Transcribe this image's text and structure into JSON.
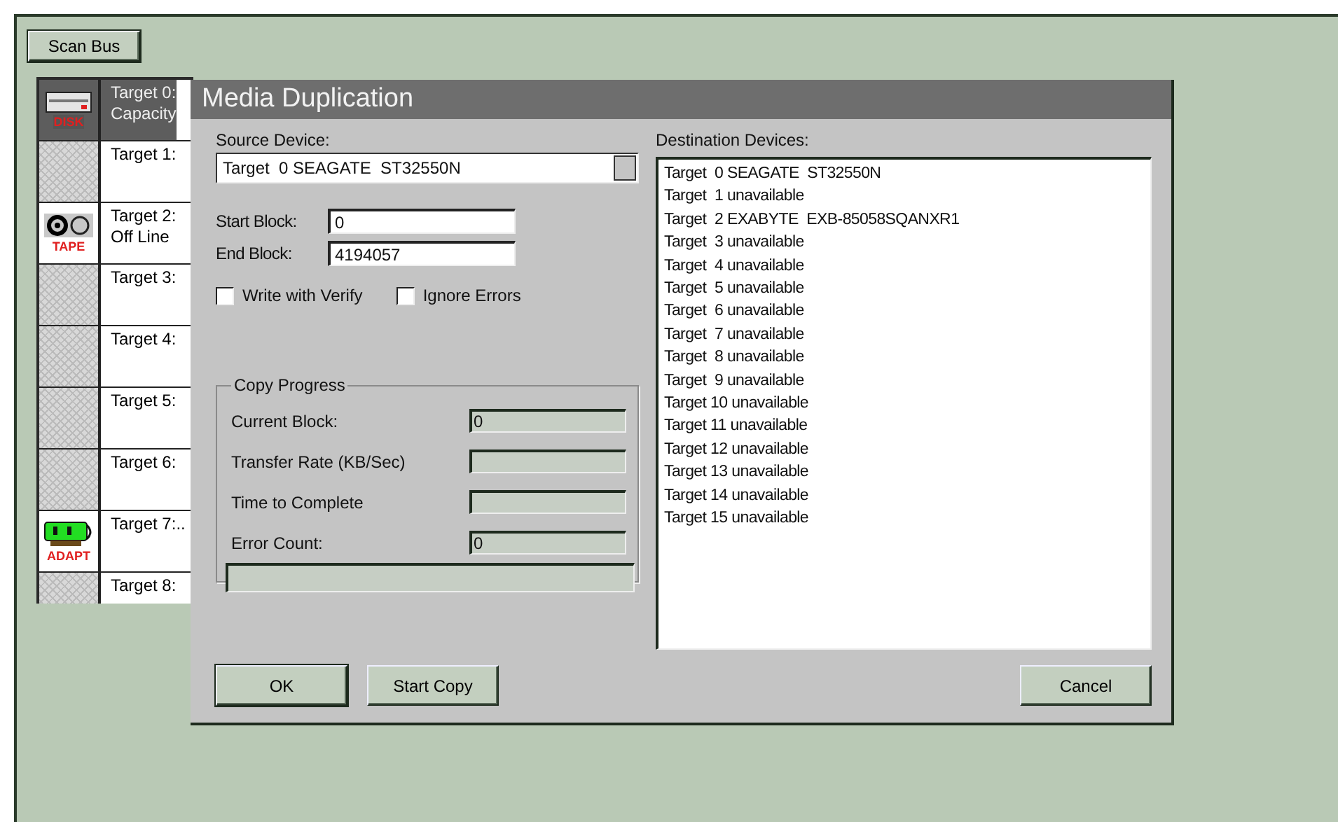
{
  "scan_button": "Scan Bus",
  "devices": [
    {
      "kind": "disk",
      "icon_label": "DISK",
      "lines": [
        "Target 0:",
        "Capacity"
      ],
      "selected": true
    },
    {
      "kind": "empty",
      "lines": [
        "Target 1:"
      ],
      "selected": false
    },
    {
      "kind": "tape",
      "icon_label": "TAPE",
      "lines": [
        "Target 2:",
        "Off Line"
      ],
      "selected": false
    },
    {
      "kind": "empty",
      "lines": [
        "Target 3:"
      ],
      "selected": false
    },
    {
      "kind": "empty",
      "lines": [
        "Target 4:"
      ],
      "selected": false
    },
    {
      "kind": "empty",
      "lines": [
        "Target 5:"
      ],
      "selected": false
    },
    {
      "kind": "empty",
      "lines": [
        "Target 6:"
      ],
      "selected": false
    },
    {
      "kind": "adapter",
      "icon_label": "ADAPT",
      "lines": [
        "Target 7:.."
      ],
      "selected": false
    },
    {
      "kind": "empty",
      "lines": [
        "Target 8:"
      ],
      "selected": false
    }
  ],
  "dialog": {
    "title": "Media Duplication",
    "source_label": "Source Device:",
    "source_value": "Target  0 SEAGATE  ST32550N",
    "fields": [
      {
        "label": "Start Block:",
        "value": "0"
      },
      {
        "label": "End Block:",
        "value": "4194057"
      }
    ],
    "options": [
      {
        "label": "Write with Verify",
        "checked": false
      },
      {
        "label": "Ignore Errors",
        "checked": false
      }
    ],
    "progress": {
      "title": "Copy Progress",
      "rows": [
        {
          "label": "Current Block:",
          "value": "0"
        },
        {
          "label": "Transfer Rate (KB/Sec)"
        },
        {
          "label": "Time to Complete"
        },
        {
          "label": "Error Count:",
          "value": "0"
        }
      ],
      "level": 0
    },
    "destination_label": "Destination Devices:",
    "destinations": [
      "Target  0 SEAGATE  ST32550N",
      "Target  1 unavailable",
      "Target  2 EXABYTE  EXB-85058SQANXR1",
      "Target  3 unavailable",
      "Target  4 unavailable",
      "Target  5 unavailable",
      "Target  6 unavailable",
      "Target  7 unavailable",
      "Target  8 unavailable",
      "Target  9 unavailable",
      "Target 10 unavailable",
      "Target 11 unavailable",
      "Target 12 unavailable",
      "Target 13 unavailable",
      "Target 14 unavailable",
      "Target 15 unavailable"
    ],
    "buttons": [
      {
        "kind": "default",
        "label": "OK"
      },
      {
        "kind": "normal",
        "label": "Start Copy"
      },
      {
        "kind": "normal",
        "label": "Cancel"
      }
    ]
  }
}
